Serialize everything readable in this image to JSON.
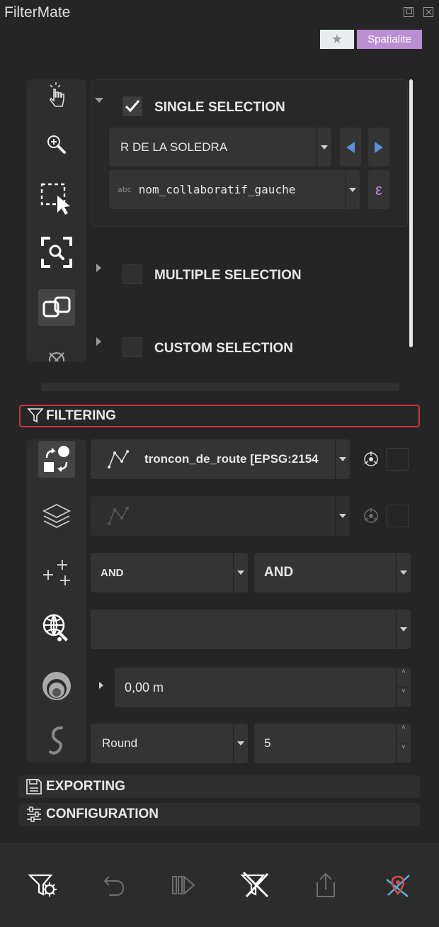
{
  "window": {
    "title": "FilterMate"
  },
  "header": {
    "favorites_icon": "star-icon",
    "favorites_glyph": "★",
    "backend_label": "Spatialite",
    "backend_color": "#b98fd1"
  },
  "selection": {
    "single": {
      "label": "SINGLE SELECTION",
      "checked": true,
      "feature_value": "R DE LA SOLEDRA",
      "field_type": "abc",
      "field_name": "nom_collaboratif_gauche",
      "expression_glyph": "ε"
    },
    "multiple": {
      "label": "MULTIPLE SELECTION",
      "checked": false
    },
    "custom": {
      "label": "CUSTOM SELECTION",
      "checked": false
    }
  },
  "filtering": {
    "label": "FILTERING",
    "source_layer": "troncon_de_route [EPSG:2154",
    "target_layer": "",
    "combine_operator_1": "AND",
    "combine_operator_2": "AND",
    "predicate": "",
    "buffer_value": "0,00 m",
    "buffer_type": "Round",
    "buffer_segments": "5",
    "accent_color": "#c8343f"
  },
  "exporting": {
    "label": "EXPORTING"
  },
  "configuration": {
    "label": "CONFIGURATION"
  }
}
